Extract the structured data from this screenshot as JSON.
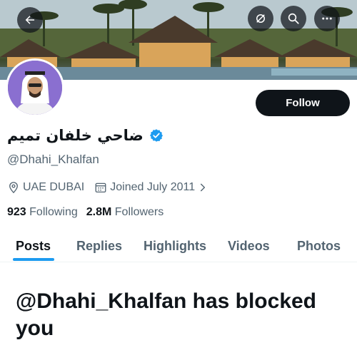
{
  "header": {
    "icons": [
      "back-arrow-icon",
      "sync-icon",
      "search-icon",
      "more-icon"
    ]
  },
  "profile": {
    "display_name": "ضاحي خلفان تميم",
    "handle": "@Dhahi_Khalfan",
    "location": "UAE DUBAI",
    "joined": "Joined July 2011",
    "following_count": "923",
    "following_label": "Following",
    "followers_count": "2.8M",
    "followers_label": "Followers",
    "verified_color": "#1d9bf0"
  },
  "actions": {
    "follow_label": "Follow"
  },
  "tabs": [
    {
      "label": "Posts",
      "active": true
    },
    {
      "label": "Replies",
      "active": false
    },
    {
      "label": "Highlights",
      "active": false
    },
    {
      "label": "Videos",
      "active": false
    },
    {
      "label": "Photos",
      "active": false
    }
  ],
  "blocked_message": "@Dhahi_Khalfan has blocked you",
  "colors": {
    "accent": "#1d9bf0",
    "text_primary": "#0f1419",
    "text_secondary": "#536471"
  }
}
